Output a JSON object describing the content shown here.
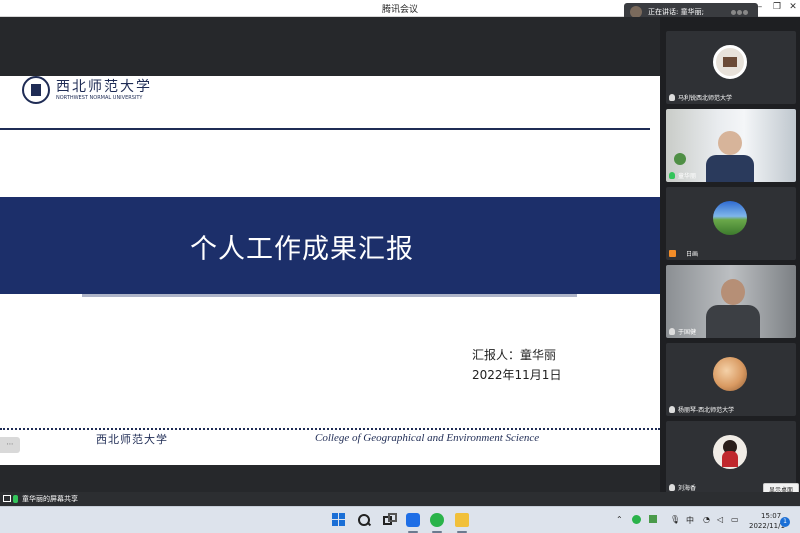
{
  "window": {
    "title": "腾讯会议",
    "speaking_label": "正在讲话: 童华丽;"
  },
  "slide": {
    "university_cn": "西北师范大学",
    "university_en": "NORTHWEST NORMAL UNIVERSITY",
    "title": "个人工作成果汇报",
    "presenter": "汇报人：童华丽",
    "date": "2022年11月1日",
    "footer_cn": "西北师范大学",
    "footer_en": "College of Geographical and Environment Science"
  },
  "participants": [
    {
      "name": "马利锐西北师范大学"
    },
    {
      "name": "童华丽"
    },
    {
      "name": "日画"
    },
    {
      "name": "于国健"
    },
    {
      "name": "杨丽琴-西北师范大学"
    },
    {
      "name": "刘海香"
    }
  ],
  "buttons": {
    "show_desktop": "显示桌面"
  },
  "share_bar": {
    "label": "童华丽的屏幕共享"
  },
  "taskbar": {
    "ime": "中",
    "time": "15:07",
    "date": "2022/11/1",
    "notification_count": "1"
  }
}
